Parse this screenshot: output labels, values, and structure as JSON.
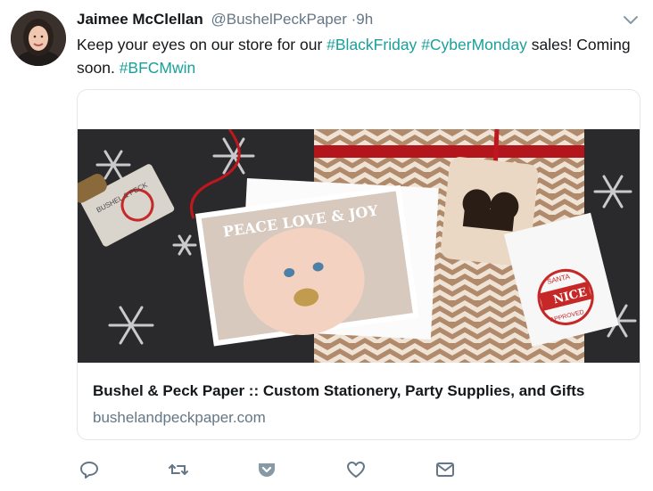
{
  "tweet": {
    "author_name": "Jaimee McClellan",
    "handle": "@BushelPeckPaper",
    "separator": "·",
    "time": "9h",
    "text_parts": [
      {
        "text": "Keep your eyes on our store for our ",
        "hashtag": false
      },
      {
        "text": "#BlackFriday",
        "hashtag": true
      },
      {
        "text": " ",
        "hashtag": false
      },
      {
        "text": "#CyberMonday",
        "hashtag": true
      },
      {
        "text": " sales! Coming soon. ",
        "hashtag": false
      },
      {
        "text": "#BFCMwin",
        "hashtag": true
      }
    ]
  },
  "card": {
    "title": "Bushel & Peck Paper :: Custom Stationery, Party Supplies, and Gifts",
    "domain": "bushelandpeckpaper.com",
    "image_text": {
      "card_greeting": "PEACE LOVE & JOY",
      "stamp_brand": "BUSHEL & PECK",
      "seal_top": "SANTA",
      "seal_middle": "NICE",
      "seal_bottom": "APPROVED"
    }
  },
  "actions": [
    "reply-icon",
    "retweet-icon",
    "pocket-icon",
    "like-icon",
    "message-icon"
  ],
  "colors": {
    "hashtag": "#1aa09a",
    "muted": "#657786",
    "text": "#14171a",
    "border": "#e1e8ed"
  }
}
